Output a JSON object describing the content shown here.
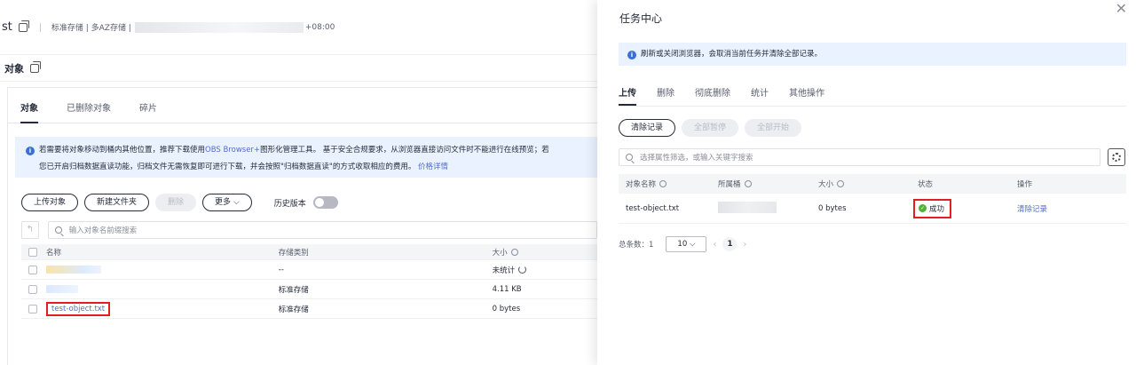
{
  "background": {
    "bucket_name_fragment": "st",
    "bucket_meta": "标准存储 | 多AZ存储 |",
    "timezone": "+08:00",
    "object_header": "对象",
    "tabs": [
      {
        "label": "对象",
        "active": true
      },
      {
        "label": "已删除对象",
        "active": false
      },
      {
        "label": "碎片",
        "active": false
      }
    ],
    "notice": {
      "line1_prefix": "若需要将对象移动到桶内其他位置，推荐下载使用",
      "line1_link": "OBS Browser+",
      "line1_suffix": "图形化管理工具。 基于安全合规要求，从浏览器直接访问文件时不能进行在线预览；若",
      "line2_text": "您已开启归档数据直读功能，归档文件无需恢复即可进行下载，并会按照\"归档数据直读\"的方式收取相应的费用。",
      "line2_link": "价格详情"
    },
    "toolbar": {
      "upload": "上传对象",
      "new_folder": "新建文件夹",
      "delete": "删除",
      "more": "更多",
      "history_version": "历史版本"
    },
    "search_placeholder": "输入对象名前缀搜索",
    "columns": [
      "名称",
      "存储类别",
      "大小"
    ],
    "rows": [
      {
        "name": "",
        "class": "--",
        "size": "未统计"
      },
      {
        "name": "",
        "class": "标准存储",
        "size": "4.11 KB"
      },
      {
        "name": "test-object.txt",
        "class": "标准存储",
        "size": "0 bytes"
      }
    ]
  },
  "drawer": {
    "title": "任务中心",
    "notice": "刷新或关闭浏览器，会取消当前任务并清除全部记录。",
    "tabs": [
      {
        "label": "上传",
        "active": true
      },
      {
        "label": "删除",
        "active": false
      },
      {
        "label": "彻底删除",
        "active": false
      },
      {
        "label": "统计",
        "active": false
      },
      {
        "label": "其他操作",
        "active": false
      }
    ],
    "buttons": {
      "clear_records": "清除记录",
      "pause_all": "全部暂停",
      "start_all": "全部开始"
    },
    "search_placeholder": "选择属性筛选，或输入关键字搜索",
    "columns": [
      "对象名称",
      "所属桶",
      "大小",
      "状态",
      "操作"
    ],
    "rows": [
      {
        "object": "test-object.txt",
        "bucket": "",
        "size": "0 bytes",
        "status": "成功",
        "action": "清除记录"
      }
    ],
    "pagination": {
      "total_label": "总条数：1",
      "page_size": "10",
      "current_page": "1"
    }
  },
  "colors": {
    "link": "#526ecc",
    "info_bg": "#eaf2ff",
    "success": "#50b432",
    "highlight": "#e02020"
  }
}
